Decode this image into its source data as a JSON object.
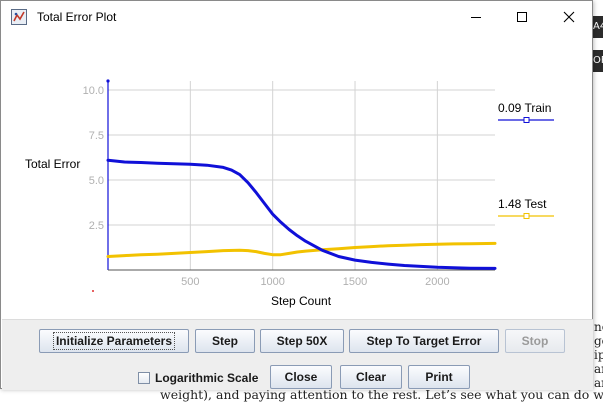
{
  "window": {
    "title": "Total Error Plot"
  },
  "background": {
    "tab_top": "A4",
    "tab_mid": "OF",
    "side_lines": [
      "ne",
      "ge",
      "ip",
      "ar",
      "ar"
    ],
    "bottom_text": "weight), and paying attention to the rest. Let’s see what you can do w"
  },
  "chart_data": {
    "type": "line",
    "xlabel": "Step Count",
    "ylabel": "Total Error",
    "xlim": [
      0,
      2350
    ],
    "ylim": [
      0,
      10.5
    ],
    "x_ticks": [
      500,
      1000,
      1500,
      2000
    ],
    "y_ticks": [
      "10.0",
      "7.5",
      "5.0",
      "2.5"
    ],
    "y_tick_values": [
      10.0,
      7.5,
      5.0,
      2.5
    ],
    "grid": true,
    "legend_position": "right",
    "series": [
      {
        "name": "Train",
        "legend_label": "0.09 Train",
        "color": "#1010d8",
        "x": [
          0,
          100,
          200,
          300,
          400,
          500,
          600,
          700,
          750,
          800,
          850,
          900,
          950,
          1000,
          1050,
          1100,
          1150,
          1200,
          1300,
          1400,
          1500,
          1600,
          1700,
          1800,
          1900,
          2000,
          2100,
          2200,
          2350
        ],
        "y": [
          6.1,
          6.0,
          5.97,
          5.93,
          5.9,
          5.87,
          5.82,
          5.7,
          5.55,
          5.3,
          4.85,
          4.3,
          3.7,
          3.1,
          2.65,
          2.25,
          1.9,
          1.6,
          1.1,
          0.75,
          0.55,
          0.42,
          0.33,
          0.25,
          0.2,
          0.15,
          0.12,
          0.1,
          0.09
        ]
      },
      {
        "name": "Test",
        "legend_label": "1.48 Test",
        "color": "#f2c200",
        "x": [
          0,
          100,
          200,
          300,
          400,
          500,
          600,
          700,
          800,
          850,
          900,
          950,
          1000,
          1050,
          1100,
          1150,
          1200,
          1300,
          1400,
          1500,
          1600,
          1700,
          1800,
          1900,
          2000,
          2100,
          2200,
          2350
        ],
        "y": [
          0.75,
          0.8,
          0.85,
          0.88,
          0.92,
          0.97,
          1.02,
          1.08,
          1.1,
          1.08,
          1.02,
          0.92,
          0.85,
          0.85,
          0.92,
          1.0,
          1.05,
          1.12,
          1.18,
          1.25,
          1.3,
          1.35,
          1.38,
          1.41,
          1.43,
          1.45,
          1.46,
          1.48
        ]
      }
    ]
  },
  "buttons": {
    "initialize": "Initialize Parameters",
    "step": "Step",
    "step50": "Step 50X",
    "step_target": "Step To Target Error",
    "stop": "Stop",
    "close": "Close",
    "clear": "Clear",
    "print": "Print"
  },
  "checkbox": {
    "log_scale_label": "Logarithmic Scale",
    "checked": false
  }
}
